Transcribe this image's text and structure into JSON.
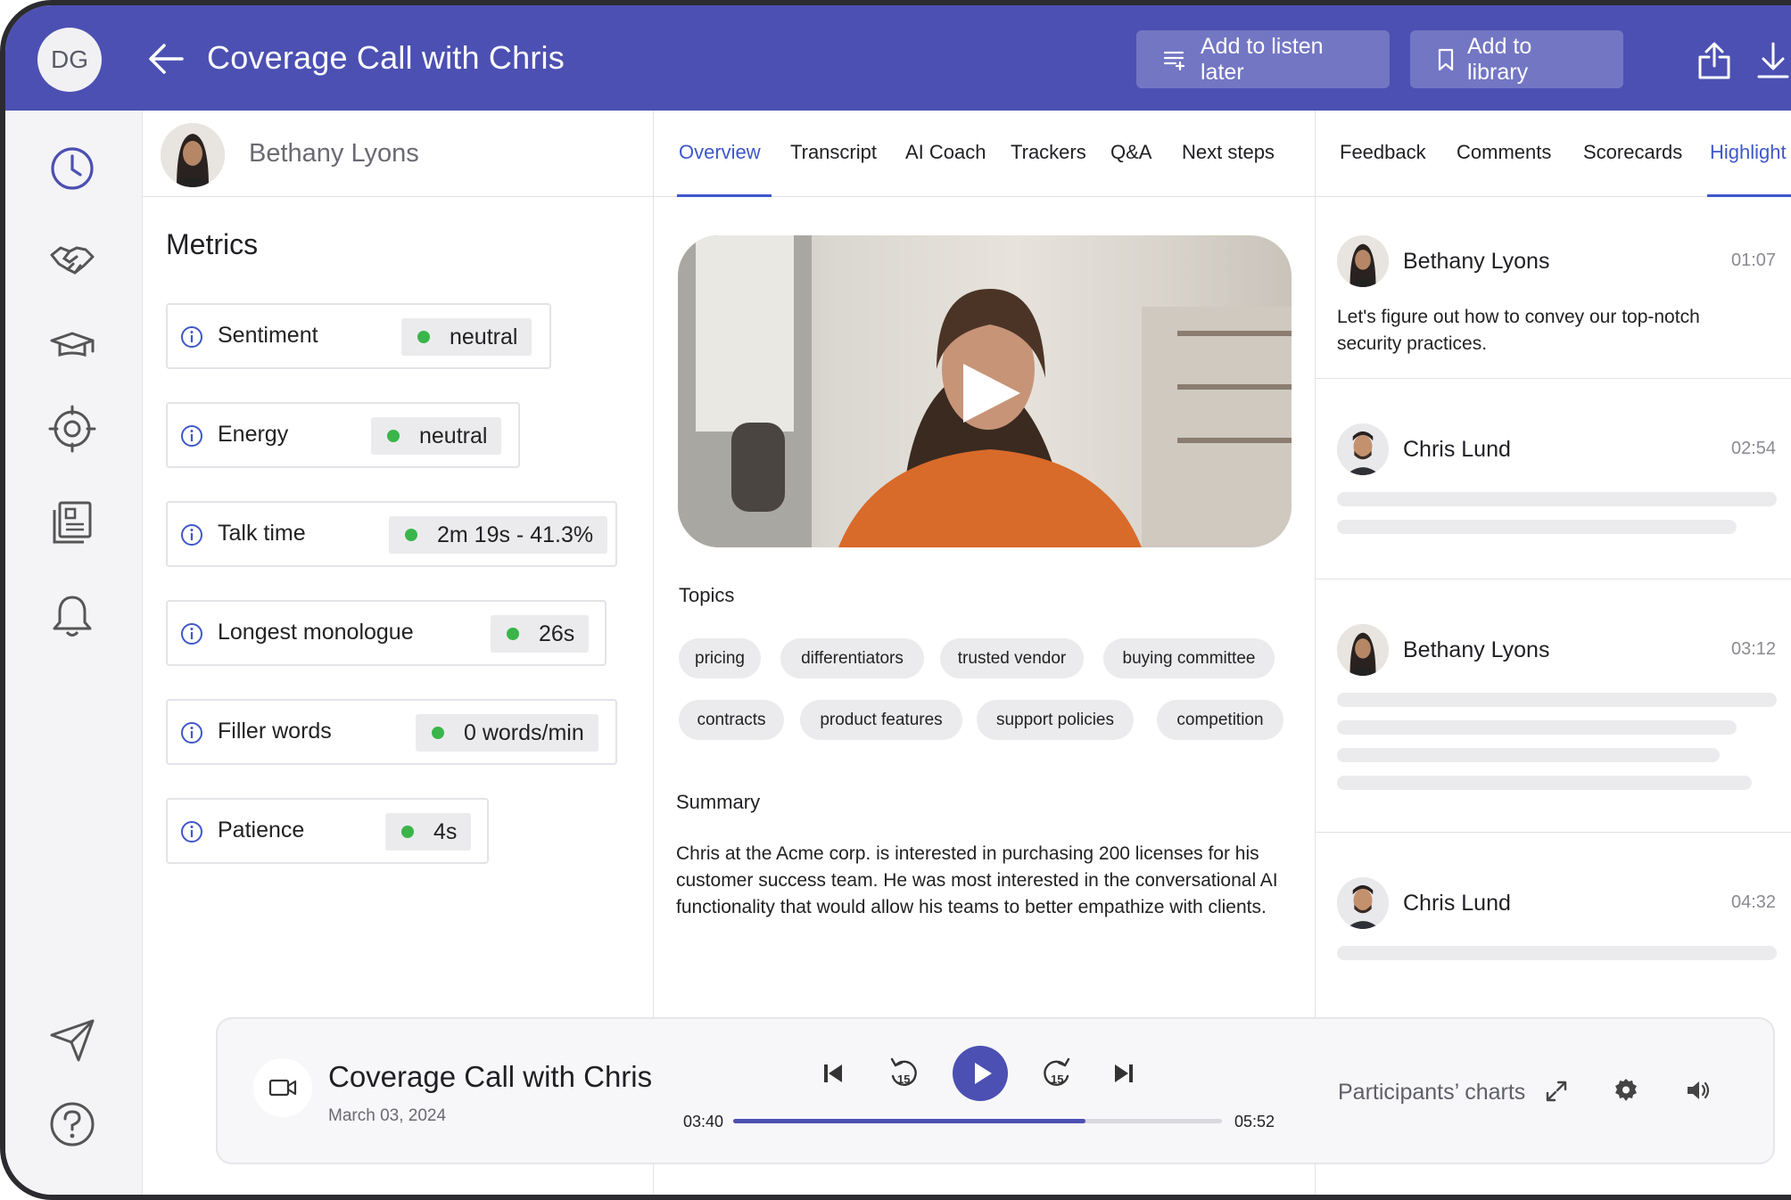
{
  "header": {
    "user_initials": "DG",
    "title": "Coverage Call with Chris",
    "listen_later_label": "Add to listen later",
    "library_label": "Add to library"
  },
  "sidebar": {
    "icons": [
      "clock-icon",
      "handshake-icon",
      "graduation-cap-icon",
      "target-icon",
      "document-icon",
      "bell-icon",
      "send-icon",
      "help-icon"
    ]
  },
  "left": {
    "person_name": "Bethany Lyons",
    "metrics_title": "Metrics",
    "metrics": [
      {
        "label": "Sentiment",
        "value": "neutral"
      },
      {
        "label": "Energy",
        "value": "neutral"
      },
      {
        "label": "Talk time",
        "value": "2m 19s - 41.3%"
      },
      {
        "label": "Longest monologue",
        "value": "26s"
      },
      {
        "label": "Filler words",
        "value": "0 words/min"
      },
      {
        "label": "Patience",
        "value": "4s"
      }
    ]
  },
  "middle": {
    "tabs": [
      "Overview",
      "Transcript",
      "AI Coach",
      "Trackers",
      "Q&A",
      "Next steps"
    ],
    "active_tab": "Overview",
    "topics_label": "Topics",
    "topics": [
      "pricing",
      "differentiators",
      "trusted vendor",
      "buying committee",
      "contracts",
      "product features",
      "support policies",
      "competition"
    ],
    "summary_label": "Summary",
    "summary_text": "Chris at the Acme corp. is interested in purchasing 200 licenses for his customer success team. He was most interested in the conversational AI functionality that would allow his teams to better empathize with clients."
  },
  "right": {
    "tabs": [
      "Feedback",
      "Comments",
      "Scorecards",
      "Highlight"
    ],
    "active_tab": "Highlight",
    "comments": [
      {
        "name": "Bethany Lyons",
        "time": "01:07",
        "text": "Let's figure out how to convey our top-notch security practices."
      },
      {
        "name": "Chris Lund",
        "time": "02:54"
      },
      {
        "name": "Bethany Lyons",
        "time": "03:12"
      },
      {
        "name": "Chris Lund",
        "time": "04:32"
      }
    ]
  },
  "player": {
    "title": "Coverage Call with Chris",
    "date": "March 03, 2024",
    "current_time": "03:40",
    "end_time": "05:52",
    "progress": 0.72,
    "rewind_seconds": "15",
    "forward_seconds": "15",
    "charts_label": "Participants’ charts"
  },
  "colors": {
    "brand": "#4c50b2",
    "active_tab": "#3f57c9",
    "status_dot": "#3ab54a"
  }
}
